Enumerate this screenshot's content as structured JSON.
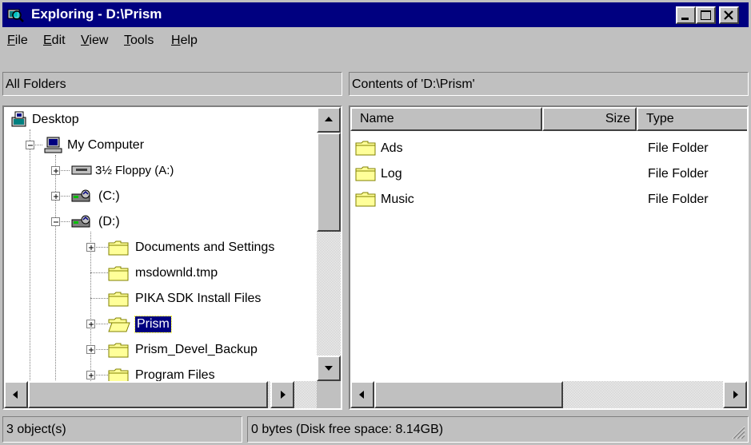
{
  "window": {
    "title": "Exploring - D:\\Prism",
    "icon": "explorer-magnifier-icon",
    "controls": [
      "minimize-icon",
      "maximize-icon",
      "close-icon"
    ]
  },
  "menu": [
    {
      "label": "File",
      "mnemonic": "F",
      "rest": "ile"
    },
    {
      "label": "Edit",
      "mnemonic": "E",
      "rest": "dit"
    },
    {
      "label": "View",
      "mnemonic": "V",
      "rest": "iew"
    },
    {
      "label": "Tools",
      "mnemonic": "T",
      "rest": "ools"
    },
    {
      "label": "Help",
      "mnemonic": "H",
      "rest": "elp"
    }
  ],
  "left_header": "All Folders",
  "right_header": "Contents of 'D:\\Prism'",
  "tree": [
    {
      "label": "Desktop",
      "icon": "desktop-icon"
    },
    {
      "label": "My Computer",
      "icon": "computer-icon",
      "expanded": true
    },
    {
      "label": "3½ Floppy (A:)",
      "icon": "floppy-drive-icon"
    },
    {
      "label": "(C:)",
      "icon": "hard-drive-icon"
    },
    {
      "label": "(D:)",
      "icon": "hard-drive-icon",
      "expanded": true
    },
    {
      "label": "Documents and Settings",
      "icon": "folder-icon"
    },
    {
      "label": "msdownld.tmp",
      "icon": "folder-icon"
    },
    {
      "label": "PIKA SDK Install Files",
      "icon": "folder-icon"
    },
    {
      "label": "Prism",
      "icon": "folder-open-icon",
      "selected": true
    },
    {
      "label": "Prism_Devel_Backup",
      "icon": "folder-icon"
    },
    {
      "label": "Program Files",
      "icon": "folder-icon"
    }
  ],
  "columns": {
    "name": "Name",
    "size": "Size",
    "type": "Type"
  },
  "files": [
    {
      "name": "Ads",
      "size": "",
      "type": "File Folder"
    },
    {
      "name": "Log",
      "size": "",
      "type": "File Folder"
    },
    {
      "name": "Music",
      "size": "",
      "type": "File Folder"
    }
  ],
  "status": {
    "objects": "3 object(s)",
    "info": "0 bytes (Disk free space: 8.14GB)"
  },
  "colors": {
    "titlebar": "#000080",
    "face": "#c0c0c0",
    "selection": "#000080",
    "folder": "#ffff99"
  }
}
